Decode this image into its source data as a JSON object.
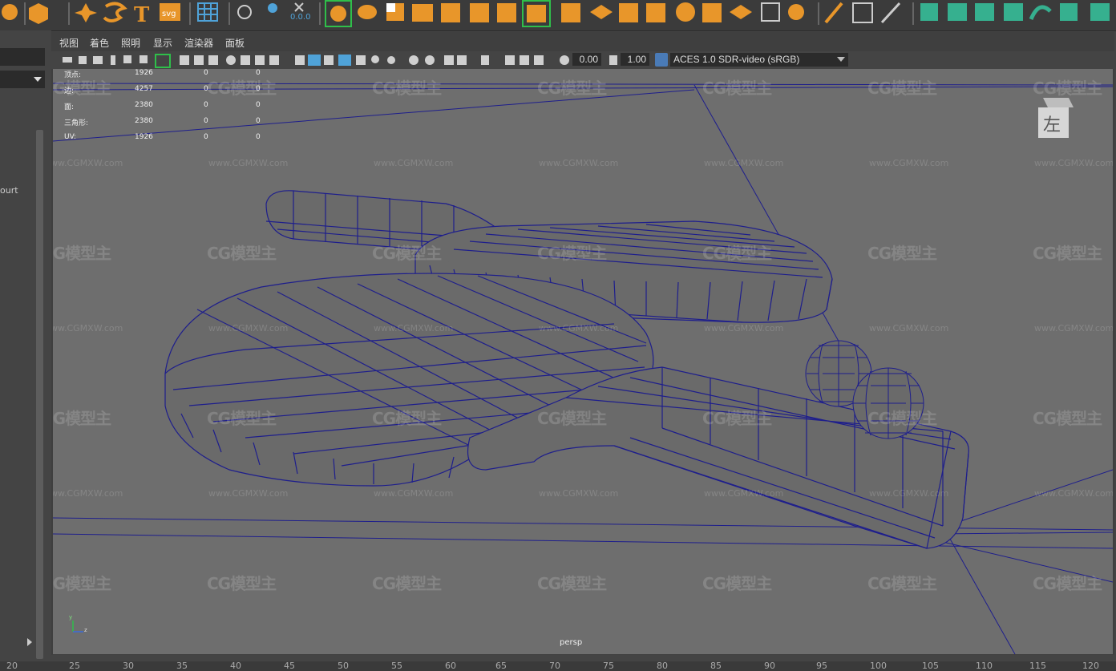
{
  "menu": {
    "items": [
      "视图",
      "着色",
      "照明",
      "显示",
      "渲染器",
      "面板"
    ]
  },
  "toolbar": {
    "exposure": "0.00",
    "gamma": "1.00",
    "color_space": "ACES 1.0 SDR-video (sRGB)"
  },
  "left_panel": {
    "text": "ourt"
  },
  "hud": {
    "rows": [
      {
        "label": "顶点:",
        "v1": "1926",
        "v2": "0",
        "v3": "0"
      },
      {
        "label": "边:",
        "v1": "4257",
        "v2": "0",
        "v3": "0"
      },
      {
        "label": "面:",
        "v1": "2380",
        "v2": "0",
        "v3": "0"
      },
      {
        "label": "三角形:",
        "v1": "2380",
        "v2": "0",
        "v3": "0"
      },
      {
        "label": "UV:",
        "v1": "1926",
        "v2": "0",
        "v3": "0"
      }
    ]
  },
  "viewcube_label": "左",
  "camera": "persp",
  "axis": {
    "y": "y",
    "z": "z"
  },
  "watermark": {
    "logo": "CG模型主",
    "url": "www.CGMXW.com"
  },
  "ruler": [
    "20",
    "25",
    "30",
    "35",
    "40",
    "45",
    "50",
    "55",
    "60",
    "65",
    "70",
    "75",
    "80",
    "85",
    "90",
    "95",
    "100",
    "105",
    "110",
    "115",
    "120"
  ],
  "colors": {
    "viewport_bg": "#6e6e6e",
    "wire": "#1e1e8c",
    "accent_orange": "#e8962a",
    "accent_green": "#36b08f"
  }
}
